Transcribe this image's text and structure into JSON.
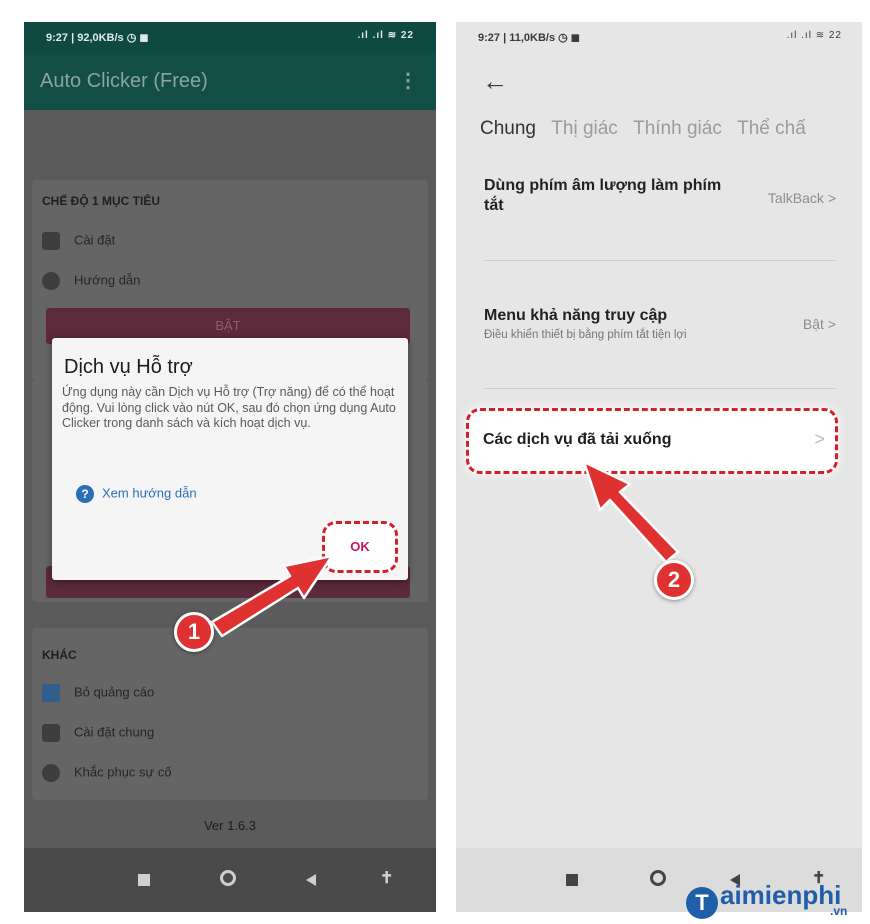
{
  "left_phone": {
    "status_bar": {
      "left": "9:27 | 92,0KB/s ◷ ◼",
      "right": ".ıl .ıl ≋ 22"
    },
    "app_bar": {
      "title": "Auto Clicker (Free)",
      "menu_icon": "more-vert-icon"
    },
    "section_single": {
      "header": "CHẾ ĐỘ 1 MỤC TIÊU",
      "items": [
        {
          "icon": "gear-icon",
          "label": "Cài đặt"
        },
        {
          "icon": "info-icon",
          "label": "Hướng dẫn"
        }
      ],
      "button": "BẬT"
    },
    "section_other": {
      "header": "KHÁC",
      "items": [
        {
          "icon": "ads-icon",
          "label": "Bỏ quảng cáo"
        },
        {
          "icon": "gear-icon",
          "label": "Cài đặt chung"
        },
        {
          "icon": "help-icon",
          "label": "Khắc phục sự cố"
        }
      ]
    },
    "version": "Ver 1.6.3",
    "dialog": {
      "title": "Dịch vụ Hỗ trợ",
      "body": "Ứng dụng này cần Dịch vụ Hỗ trợ (Trợ năng) để có thể hoạt động. Vui lòng click vào nút OK, sau đó chọn ứng dụng Auto Clicker trong danh sách và kích hoạt dịch vụ.",
      "help_link": "Xem hướng dẫn",
      "ok": "OK"
    }
  },
  "right_phone": {
    "status_bar": {
      "left": "9:27 | 11,0KB/s ◷ ◼",
      "right": ".ıl .ıl ≋ 22"
    },
    "tabs": [
      "Chung",
      "Thị giác",
      "Thính giác",
      "Thể chấ"
    ],
    "settings": [
      {
        "title": "Dùng phím âm lượng làm phím tắt",
        "value": "TalkBack >"
      },
      {
        "title": "Menu khả năng truy cập",
        "subtitle": "Điều khiển thiết bị bằng phím tắt tiện lợi",
        "value": "Bật >"
      }
    ],
    "highlighted_item": {
      "title": "Các dịch vụ đã tải xuống",
      "chevron": ">"
    }
  },
  "annotations": {
    "step1": "1",
    "step2": "2",
    "accent": "#e03131"
  },
  "watermark": {
    "brand": "aimienphi",
    "suffix": ".vn"
  }
}
